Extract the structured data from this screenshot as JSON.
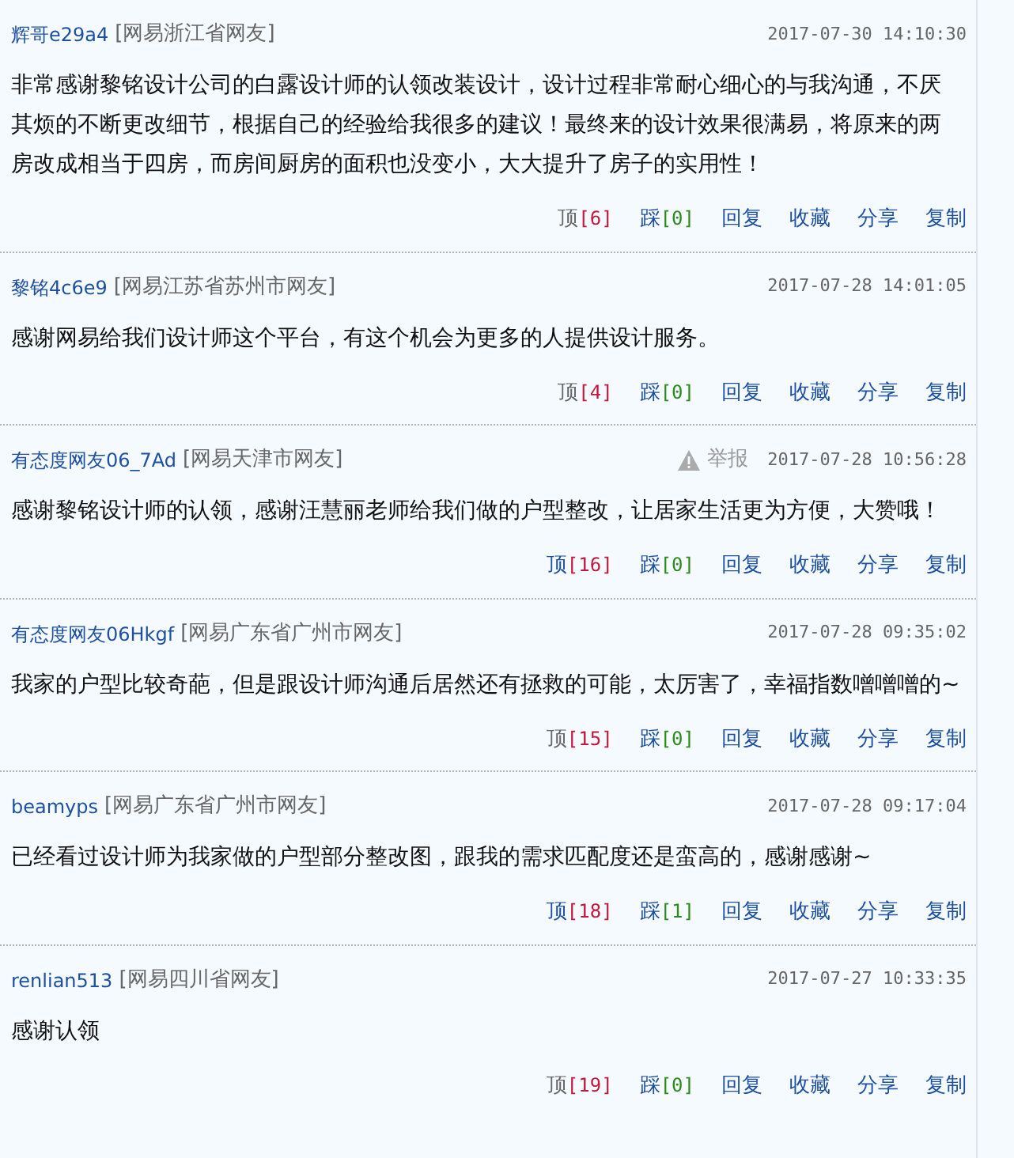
{
  "comments": [
    {
      "user": "辉哥e29a4",
      "location": "[网易浙江省网友]",
      "time": "2017-07-30 14:10:30",
      "body": "非常感谢黎铭设计公司的白露设计师的认领改装设计，设计过程非常耐心细心的与我沟通，不厌其烦的不断更改细节，根据自己的经验给我很多的建议！最终来的设计效果很满易，将原来的两房改成相当于四房，而房间厨房的面积也没变小，大大提升了房子的实用性！",
      "up_label": "顶",
      "up_count": "[6]",
      "up_active": false,
      "down_label": "踩",
      "down_count": "[0]",
      "actions": [
        "回复",
        "收藏",
        "分享",
        "复制"
      ]
    },
    {
      "user": "黎铭4c6e9",
      "location": "[网易江苏省苏州市网友]",
      "time": "2017-07-28 14:01:05",
      "body": "感谢网易给我们设计师这个平台，有这个机会为更多的人提供设计服务。",
      "up_label": "顶",
      "up_count": "[4]",
      "up_active": false,
      "down_label": "踩",
      "down_count": "[0]",
      "actions": [
        "回复",
        "收藏",
        "分享",
        "复制"
      ]
    },
    {
      "user": "有态度网友06_7Ad",
      "location": "[网易天津市网友]",
      "report": "举报",
      "time": "2017-07-28 10:56:28",
      "body": "感谢黎铭设计师的认领，感谢汪慧丽老师给我们做的户型整改，让居家生活更为方便，大赞哦！",
      "up_label": "顶",
      "up_count": "[16]",
      "up_active": true,
      "down_label": "踩",
      "down_count": "[0]",
      "actions": [
        "回复",
        "收藏",
        "分享",
        "复制"
      ]
    },
    {
      "user": "有态度网友06Hkgf",
      "location": "[网易广东省广州市网友]",
      "time": "2017-07-28 09:35:02",
      "body": "我家的户型比较奇葩，但是跟设计师沟通后居然还有拯救的可能，太厉害了，幸福指数噌噌噌的~",
      "up_label": "顶",
      "up_count": "[15]",
      "up_active": false,
      "down_label": "踩",
      "down_count": "[0]",
      "actions": [
        "回复",
        "收藏",
        "分享",
        "复制"
      ]
    },
    {
      "user": "beamyps",
      "location": "[网易广东省广州市网友]",
      "time": "2017-07-28 09:17:04",
      "body": "已经看过设计师为我家做的户型部分整改图，跟我的需求匹配度还是蛮高的，感谢感谢~",
      "up_label": "顶",
      "up_count": "[18]",
      "up_active": true,
      "down_label": "踩",
      "down_count": "[1]",
      "actions": [
        "回复",
        "收藏",
        "分享",
        "复制"
      ]
    },
    {
      "user": "renlian513",
      "location": "[网易四川省网友]",
      "time": "2017-07-27 10:33:35",
      "body": "感谢认领",
      "up_label": "顶",
      "up_count": "[19]",
      "up_active": false,
      "down_label": "踩",
      "down_count": "[0]",
      "actions": [
        "回复",
        "收藏",
        "分享",
        "复制"
      ]
    }
  ]
}
